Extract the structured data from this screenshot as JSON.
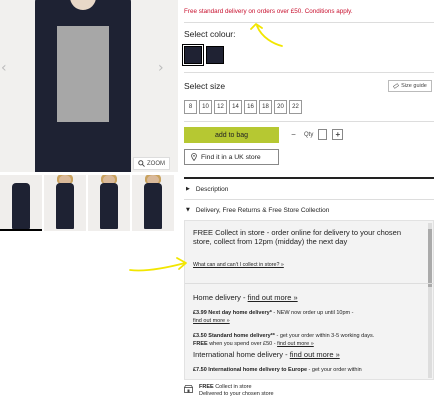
{
  "gallery": {
    "zoom_label": "ZOOM",
    "thumbnails": [
      {
        "kind": "dress"
      },
      {
        "kind": "model"
      },
      {
        "kind": "model"
      },
      {
        "kind": "model"
      }
    ]
  },
  "product": {
    "promo": "Free standard delivery on orders over £50. Conditions apply.",
    "colour_label": "Select colour:",
    "size_label": "Select size",
    "size_guide_label": "Size guide",
    "sizes": [
      "8",
      "10",
      "12",
      "14",
      "16",
      "18",
      "20",
      "22"
    ],
    "add_to_bag": "add to bag",
    "qty_label": "Qty",
    "qty_minus": "−",
    "qty_value": "1",
    "qty_plus": "+",
    "find_in_store": "Find it in a UK store",
    "accordion": {
      "description": "Description",
      "delivery": "Delivery, Free Returns & Free Store Collection"
    },
    "panel": {
      "collect_head": "FREE Collect in store - order online for delivery to your chosen store, collect from 12pm (midday) the next day",
      "collect_link": "What can and can't I collect in store? »",
      "home_head": "Home delivery - ",
      "home_link": "find out more »",
      "next_day_price": "£3.99 Next day home delivery*",
      "next_day_text": " - NEW now order up until 10pm - ",
      "next_day_link": "find out more »",
      "standard_price": "£3.50 Standard home delivery**",
      "standard_text": " - get your order within 3-5 working days. ",
      "standard_free": "FREE",
      "standard_text2": " when you spend over £50 - ",
      "standard_link": "find out more »",
      "intl_head": "International home delivery - ",
      "intl_link": "find out more »",
      "europe_price": "£7.50 International home delivery to Europe",
      "europe_text": " - get your order within"
    },
    "collect_footer_bold": "FREE",
    "collect_footer_text": " Collect in store",
    "collect_footer_line2": "Delivered to your chosen store"
  },
  "colors": {
    "promo_red": "#c8102e",
    "add_to_bag_green": "#b6c832",
    "annotation_yellow": "#f2e600",
    "dress_navy": "#1e2233"
  }
}
